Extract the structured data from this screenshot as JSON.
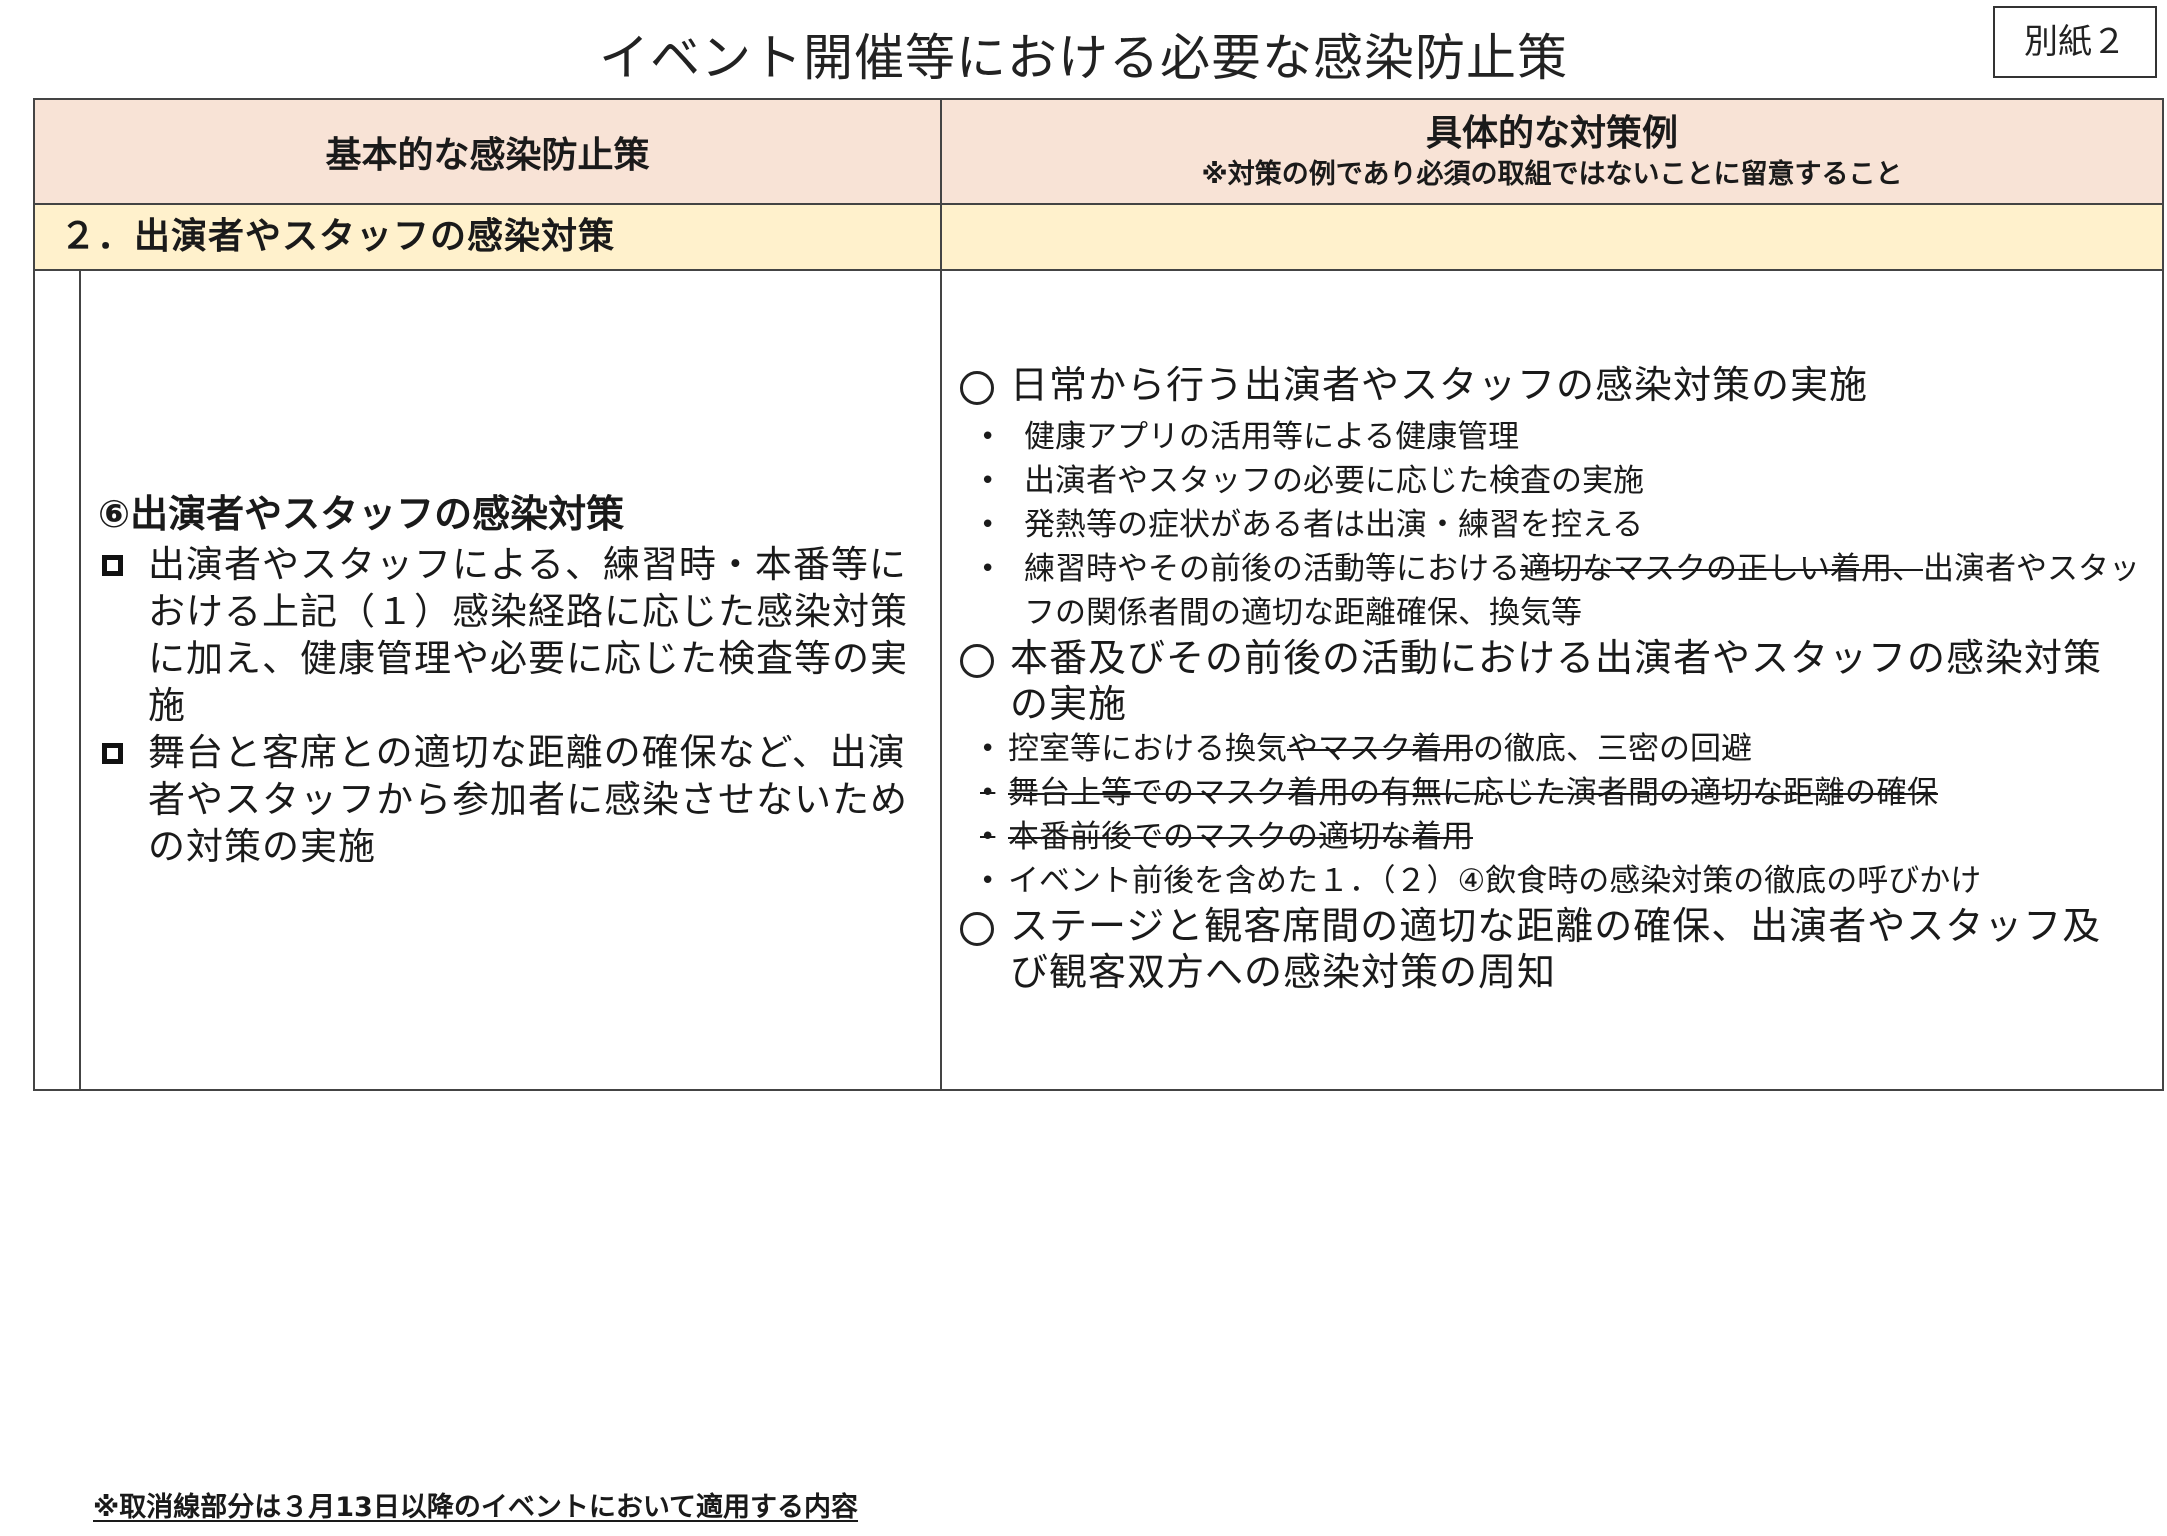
{
  "page": {
    "title": "イベント開催等における必要な感染防止策",
    "tag": "別紙２"
  },
  "header": {
    "left": "基本的な感染防止策",
    "right_main": "具体的な対策例",
    "right_sub": "※対策の例であり必須の取組ではないことに留意すること"
  },
  "section": {
    "title": "２．出演者やスタッフの感染対策"
  },
  "left": {
    "item_title": "⑥出演者やスタッフの感染対策",
    "checks": [
      "出演者やスタッフによる、練習時・本番等における上記（１）感染経路に応じた感染対策に加え、健康管理や必要に応じた検査等の実施",
      "舞台と客席との適切な距離の確保など、出演者やスタッフから参加者に感染させないための対策の実施"
    ]
  },
  "right": {
    "group1": {
      "heading": "日常から行う出演者やスタッフの感染対策の実施",
      "b1": "健康アプリの活用等による健康管理",
      "b2": "出演者やスタッフの必要に応じた検査の実施",
      "b3": "発熱等の症状がある者は出演・練習を控える",
      "b4_a": "練習時やその前後の活動等における",
      "b4_strike": "適切なマスクの正しい着用、",
      "b4_b": "出演者やスタッフの関係者間の適切な距離確保、換気等"
    },
    "group2": {
      "heading": "本番及びその前後の活動における出演者やスタッフの感染対策の実施",
      "b1_a": "控室等における換気",
      "b1_strike": "やマスク着用",
      "b1_b": "の徹底、三密の回避",
      "b2_strike": "舞台上等でのマスク着用の有無に応じた演者間の適切な距離の確保",
      "b3_strike": "本番前後でのマスクの適切な着用",
      "b4": "イベント前後を含めた１．（２）④飲食時の感染対策の徹底の呼びかけ"
    },
    "group3": {
      "heading": "ステージと観客席間の適切な距離の確保、出演者やスタッフ及び観客双方への感染対策の周知"
    }
  },
  "footnote": "※取消線部分は３月13日以降のイベントにおいて適用する内容",
  "colors": {
    "header_bg": "#f8e3d6",
    "section_bg": "#fff1cc",
    "border": "#444444"
  }
}
